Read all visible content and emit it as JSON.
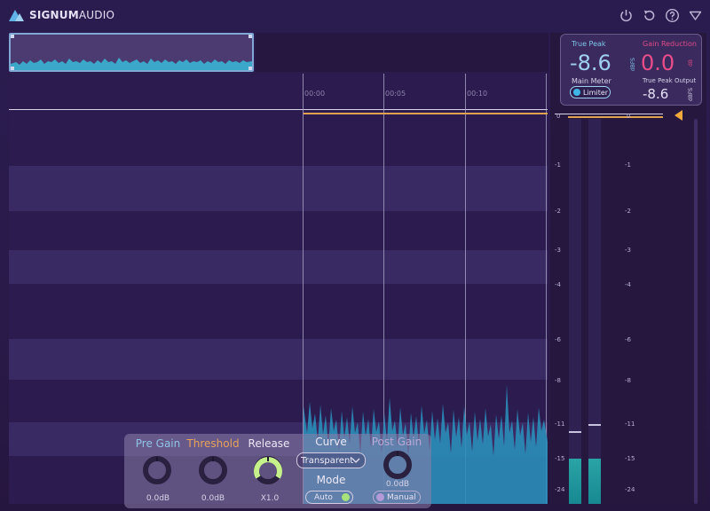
{
  "app": {
    "brand_bold": "SIGNUM",
    "brand_light": "AUDIO"
  },
  "header_icons": [
    "power-icon",
    "undo-icon",
    "help-icon",
    "menu-triangle-icon"
  ],
  "timeline": {
    "labels": [
      "00:00",
      "00:05",
      "00:10"
    ]
  },
  "readout": {
    "true_peak_label": "True Peak",
    "true_peak_value": "-8.6",
    "true_peak_unit": "dBFS",
    "gain_reduction_label": "Gain Reduction",
    "gain_reduction_value": "0.0",
    "gain_reduction_unit": "dB",
    "main_meter_label": "Main Meter",
    "limiter_label": "Limiter",
    "true_peak_output_label": "True Peak Output",
    "true_peak_output_value": "-8.6",
    "true_peak_output_unit": "dBFS"
  },
  "meter_scale": [
    "0",
    "-1",
    "-2",
    "-3",
    "-4",
    "-6",
    "-8",
    "-11",
    "-15",
    "-24"
  ],
  "meters": {
    "left_level_db": -15,
    "right_level_db": -15,
    "right_peak_db": -11
  },
  "controls": {
    "pre_gain_label": "Pre Gain",
    "pre_gain_value": "0.0dB",
    "threshold_label": "Threshold",
    "threshold_value": "0.0dB",
    "release_label": "Release",
    "release_value": "X1.0",
    "curve_label": "Curve",
    "curve_value": "Transparent",
    "mode_label": "Mode",
    "mode_auto": "Auto",
    "mode_manual": "Manual",
    "post_gain_label": "Post Gain",
    "post_gain_value": "0.0dB"
  },
  "colors": {
    "true_peak": "#9fd0f0",
    "gain_reduction": "#ea4d8a",
    "pre_gain_label": "#8fc3e6",
    "threshold_label": "#e8a35a",
    "release_accent": "#c6f08a",
    "threshold_line": "#e0a24f",
    "meter_fill": "#2aa4a6"
  }
}
